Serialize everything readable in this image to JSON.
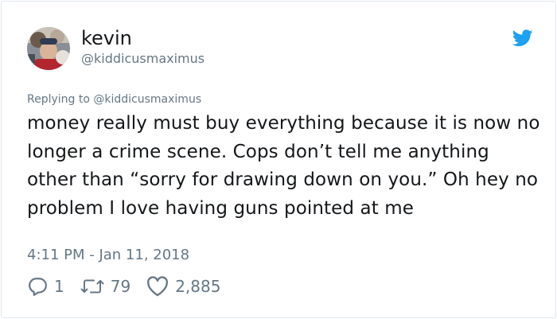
{
  "user": {
    "display_name": "kevin",
    "handle": "@kiddicusmaximus"
  },
  "tweet": {
    "replying_prefix": "Replying to",
    "replying_to": "@kiddicusmaximus",
    "text": "money really must buy everything because it is now no longer a crime scene. Cops don’t tell me anything other than “sorry for drawing down on you.” Oh hey no problem I love having guns pointed at me",
    "timestamp": "4:11 PM - Jan 11, 2018"
  },
  "stats": {
    "replies": "1",
    "retweets": "79",
    "likes": "2,885"
  },
  "icons": {
    "brand": "twitter-bird-icon",
    "reply": "reply-icon",
    "retweet": "retweet-icon",
    "like": "heart-icon"
  },
  "colors": {
    "brand": "#1da1f2",
    "text": "#14171a",
    "muted": "#657786",
    "border": "#e1e8ed"
  }
}
